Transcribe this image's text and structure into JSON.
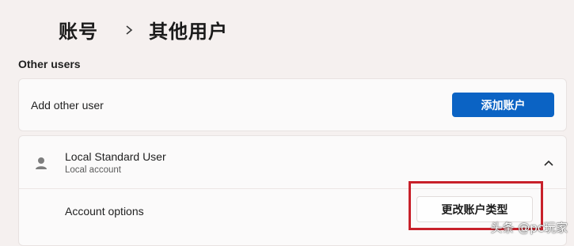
{
  "breadcrumb": {
    "root": "账号",
    "separator_icon": "chevron-right-icon",
    "current": "其他用户"
  },
  "section": {
    "title": "Other users"
  },
  "add_user": {
    "label": "Add other user",
    "button_label": "添加账户",
    "button_color": "#0b63c4"
  },
  "user_card": {
    "avatar_icon": "person-icon",
    "name": "Local Standard User",
    "subtitle": "Local account",
    "expand_icon": "chevron-up-icon",
    "options_label": "Account options",
    "change_type_button": "更改账户类型"
  },
  "annotation": {
    "highlight_color": "#c8202a"
  },
  "watermark": "头条 @pc玩家"
}
